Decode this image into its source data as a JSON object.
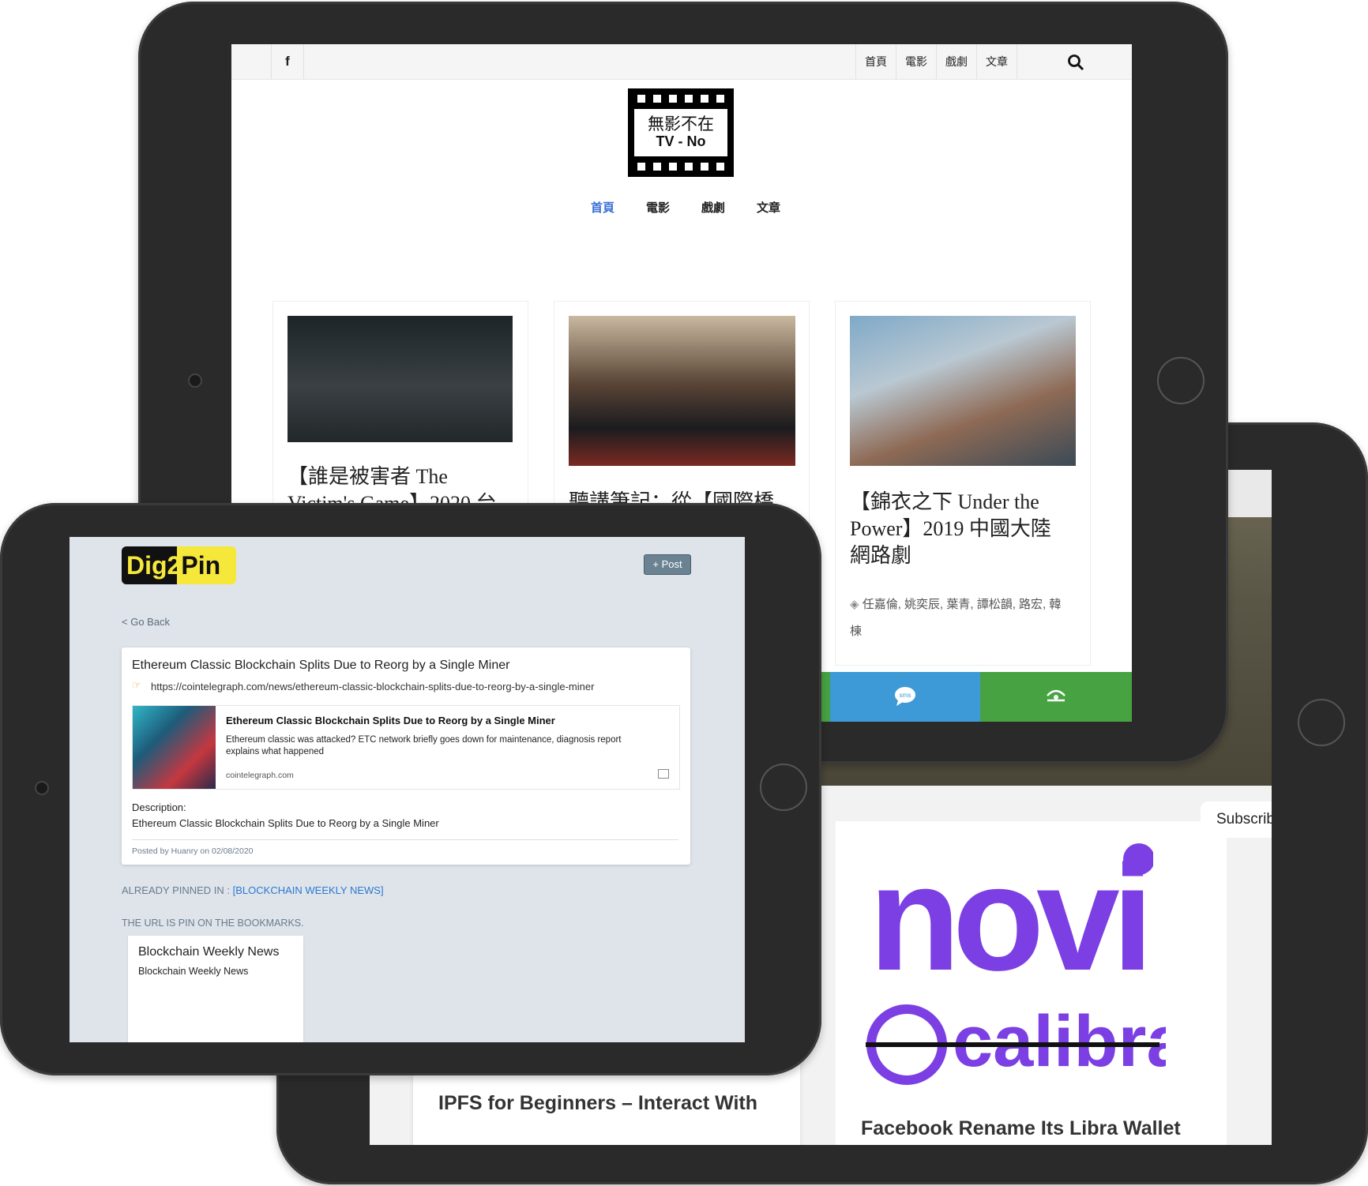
{
  "tv_site": {
    "topbar": {
      "facebook": "f",
      "nav": [
        "首頁",
        "電影",
        "戲劇",
        "文章"
      ]
    },
    "logo": {
      "line1": "無影不在",
      "line2": "TV - No"
    },
    "main_nav": [
      "首頁",
      "電影",
      "戲劇",
      "文章"
    ],
    "posts": [
      {
        "title": "【誰是被害者 The Victim's Game】2020 台"
      },
      {
        "title": "聽講筆記：從【國際橋"
      },
      {
        "title": "【錦衣之下 Under the Power】2019 中國大陸網路劇",
        "tags": "任嘉倫, 姚奕辰, 葉青, 譚松韻, 路宏, 韓棟"
      }
    ],
    "share": {
      "sms": "sms"
    }
  },
  "dig2pin": {
    "brand_left": "Dig",
    "brand_mid": "2",
    "brand_right": "Pin",
    "post_button": "+ Post",
    "go_back": "< Go Back",
    "post": {
      "title": "Ethereum Classic Blockchain Splits Due to Reorg by a Single Miner",
      "url": "https://cointelegraph.com/news/ethereum-classic-blockchain-splits-due-to-reorg-by-a-single-miner",
      "preview_title": "Ethereum Classic Blockchain Splits Due to Reorg by a Single Miner",
      "preview_desc": "Ethereum classic was attacked? ETC network briefly goes down for maintenance, diagnosis report explains what happened",
      "preview_site": "cointelegraph.com",
      "description_label": "Description:",
      "description": "Ethereum Classic Blockchain Splits Due to Reorg by a Single Miner",
      "posted_by": "Posted by Huanry on 02/08/2020"
    },
    "pinned_label": "ALREADY PINNED IN : ",
    "pinned_link": "[BLOCKCHAIN WEEKLY NEWS]",
    "url_pin_text": "THE URL IS PIN ON THE BOOKMARKS.",
    "bookmark": {
      "name": "Blockchain Weekly News",
      "desc": "Blockchain Weekly News"
    }
  },
  "blog": {
    "subscribe": "Subscribe",
    "card1_title": "IPFS for Beginners – Interact With",
    "card2_title": "Facebook Rename Its Libra Wallet",
    "novi": "novi",
    "calibra": "calibra"
  },
  "colors": {
    "accent_blue": "#3a6fd8",
    "novi_purple": "#7b3fe4",
    "share_blue": "#3d9ad6",
    "share_green": "#47a342",
    "dig2pin_yellow": "#f6e83a"
  }
}
